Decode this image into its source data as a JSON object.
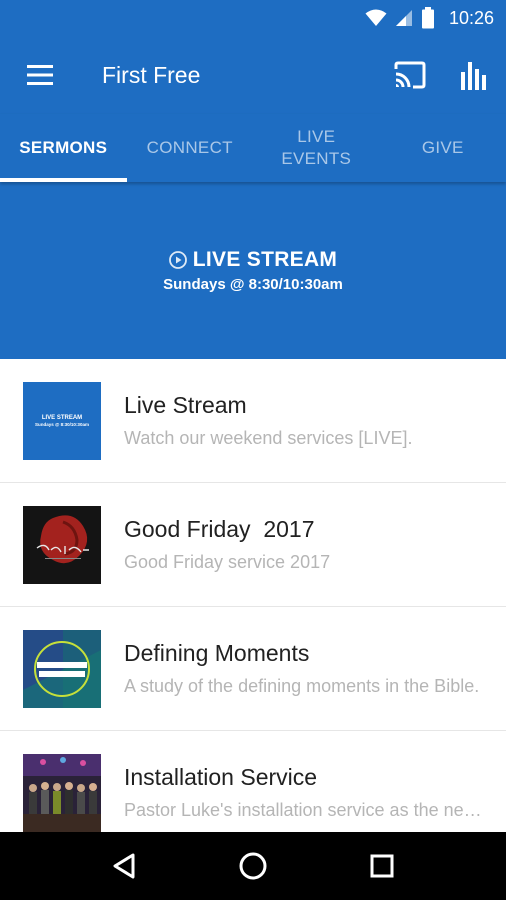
{
  "status_bar": {
    "time": "10:26"
  },
  "app_bar": {
    "title": "First Free"
  },
  "tabs": [
    {
      "label": "SERMONS",
      "active": true
    },
    {
      "label": "CONNECT",
      "active": false
    },
    {
      "label": "LIVE\nEVENTS",
      "active": false
    },
    {
      "label": "GIVE",
      "active": false
    }
  ],
  "banner": {
    "title": "LIVE STREAM",
    "subtitle": "Sundays @ 8:30/10:30am"
  },
  "list": [
    {
      "title": "Live Stream",
      "subtitle": "Watch our weekend services [LIVE].",
      "thumb_text": "LIVE STREAM",
      "thumb_subtext": "Sundays @ 8:30/10:30am"
    },
    {
      "title": "Good Friday  2017",
      "subtitle": "Good Friday service 2017"
    },
    {
      "title": "Defining Moments",
      "subtitle": "A study of the defining moments in the Bible."
    },
    {
      "title": "Installation Service",
      "subtitle": "Pastor Luke's installation service as the new pastor."
    }
  ],
  "colors": {
    "primary": "#1e6dc2",
    "title_text": "#212121",
    "subtitle_text": "#b5b5b5"
  }
}
